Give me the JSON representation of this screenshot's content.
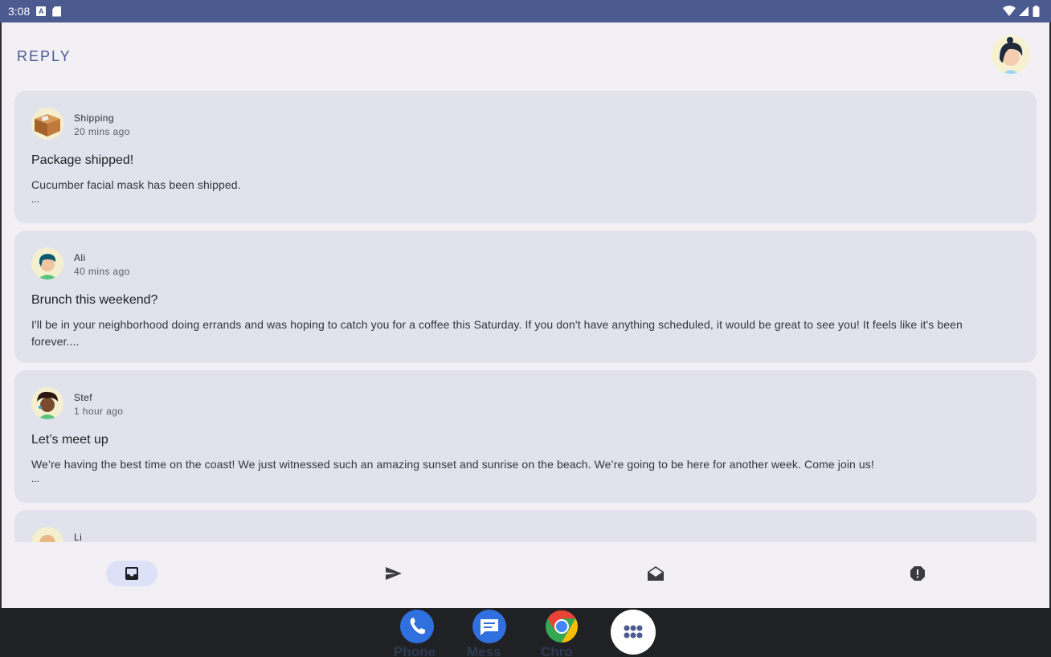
{
  "status_bar": {
    "time": "3:08"
  },
  "app": {
    "title": "REPLY"
  },
  "emails": [
    {
      "sender": "Shipping",
      "time": "20 mins ago",
      "subject": "Package shipped!",
      "body": "Cucumber facial mask has been shipped.",
      "ellipsis": "..."
    },
    {
      "sender": "Ali",
      "time": "40 mins ago",
      "subject": "Brunch this weekend?",
      "body": "I'll be in your neighborhood doing errands and was hoping to catch you for a coffee this Saturday. If you don't have anything scheduled, it would be great to see you! It feels like it's been forever....",
      "ellipsis": ""
    },
    {
      "sender": "Stef",
      "time": "1 hour ago",
      "subject": "Let’s meet up",
      "body": "We’re having the best time on the coast! We just witnessed such an amazing sunset and sunrise on the beach. We’re going to be here for another week. Come join us!",
      "ellipsis": "..."
    },
    {
      "sender": "Li",
      "time": "",
      "subject": "",
      "body": "",
      "ellipsis": ""
    }
  ],
  "bottom_nav": [
    {
      "icon": "inbox-icon",
      "active": true
    },
    {
      "icon": "send-icon",
      "active": false
    },
    {
      "icon": "drafts-icon",
      "active": false
    },
    {
      "icon": "report-icon",
      "active": false
    }
  ],
  "dock": [
    {
      "label": "Phone",
      "icon": "phone-icon",
      "color": "#2f6fde"
    },
    {
      "label": "Mess",
      "icon": "messages-icon",
      "color": "#2f6fde"
    },
    {
      "label": "Chro",
      "icon": "chrome-icon",
      "color": "#4285f4"
    }
  ],
  "colors": {
    "status_bar": "#4b5b8f",
    "brand": "#4a5a96",
    "card": "#e1e2eb",
    "active_nav": "#dde1f7",
    "taskbar": "#202124"
  }
}
